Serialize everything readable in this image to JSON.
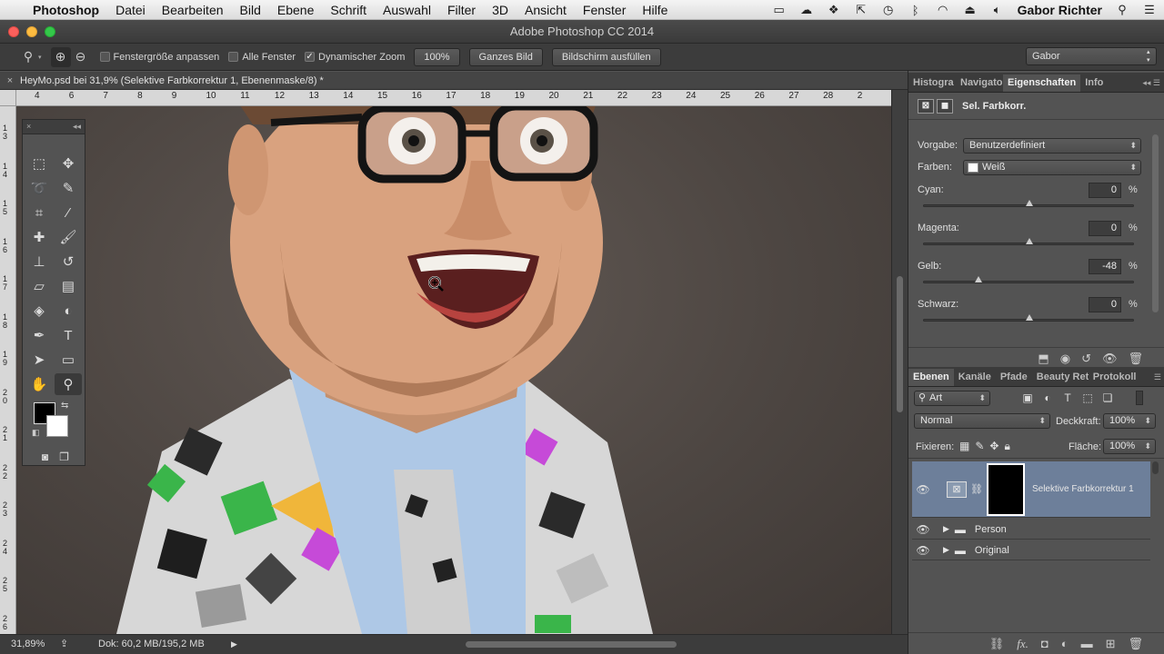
{
  "menubar": {
    "apple": "",
    "app": "Photoshop",
    "items": [
      "Datei",
      "Bearbeiten",
      "Bild",
      "Ebene",
      "Schrift",
      "Auswahl",
      "Filter",
      "3D",
      "Ansicht",
      "Fenster",
      "Hilfe"
    ],
    "user": "Gabor Richter"
  },
  "window": {
    "title": "Adobe Photoshop CC 2014"
  },
  "options": {
    "fit_window": "Fenstergröße anpassen",
    "all_windows": "Alle Fenster",
    "scrubby_zoom": "Dynamischer Zoom",
    "btn_100": "100%",
    "btn_fit": "Ganzes Bild",
    "btn_fill": "Bildschirm ausfüllen",
    "workspace": "Gabor"
  },
  "document": {
    "tab_title": "HeyMo.psd bei 31,9% (Selektive Farbkorrektur 1, Ebenenmaske/8) *"
  },
  "ruler": {
    "h_labels": [
      "4",
      "6",
      "7",
      "8",
      "9",
      "10",
      "11",
      "12",
      "13",
      "14",
      "15",
      "16",
      "17",
      "18",
      "19",
      "20",
      "21",
      "22",
      "23",
      "24",
      "25",
      "26",
      "27",
      "28",
      "2"
    ],
    "v_labels": [
      "1\n3",
      "1\n4",
      "1\n5",
      "1\n6",
      "1\n7",
      "1\n8",
      "1\n9",
      "2\n0",
      "2\n1",
      "2\n2",
      "2\n3",
      "2\n4",
      "2\n5",
      "2\n6"
    ]
  },
  "status": {
    "zoom": "31,89%",
    "doc_size": "Dok: 60,2 MB/195,2 MB"
  },
  "properties_panel": {
    "tabs": [
      "Histogra",
      "Navigato",
      "Eigenschaften",
      "Info"
    ],
    "active_tab": 2,
    "adjustment_title": "Sel. Farbkorr.",
    "preset_label": "Vorgabe:",
    "preset_value": "Benutzerdefiniert",
    "colors_label": "Farben:",
    "colors_value": "Weiß",
    "sliders": [
      {
        "label": "Cyan:",
        "value": "0",
        "unit": "%",
        "fraction": 0.5
      },
      {
        "label": "Magenta:",
        "value": "0",
        "unit": "%",
        "fraction": 0.5
      },
      {
        "label": "Gelb:",
        "value": "-48",
        "unit": "%",
        "fraction": 0.26
      },
      {
        "label": "Schwarz:",
        "value": "0",
        "unit": "%",
        "fraction": 0.5
      }
    ]
  },
  "layers_panel": {
    "tabs": [
      "Ebenen",
      "Kanäle",
      "Pfade",
      "Beauty Ret",
      "Protokoll"
    ],
    "active_tab": 0,
    "filter": "Art",
    "blend_mode": "Normal",
    "opacity_label": "Deckkraft:",
    "opacity_value": "100%",
    "lock_label": "Fixieren:",
    "fill_label": "Fläche:",
    "fill_value": "100%",
    "layers": [
      {
        "name": "Selektive Farbkorrektur 1",
        "type": "adjustment",
        "selected": true
      },
      {
        "name": "Person",
        "type": "group",
        "selected": false
      },
      {
        "name": "Original",
        "type": "group",
        "selected": false
      }
    ]
  },
  "colors": {
    "selected_layer": "#6d7f9a",
    "foreground": "#000000",
    "background": "#ffffff"
  }
}
